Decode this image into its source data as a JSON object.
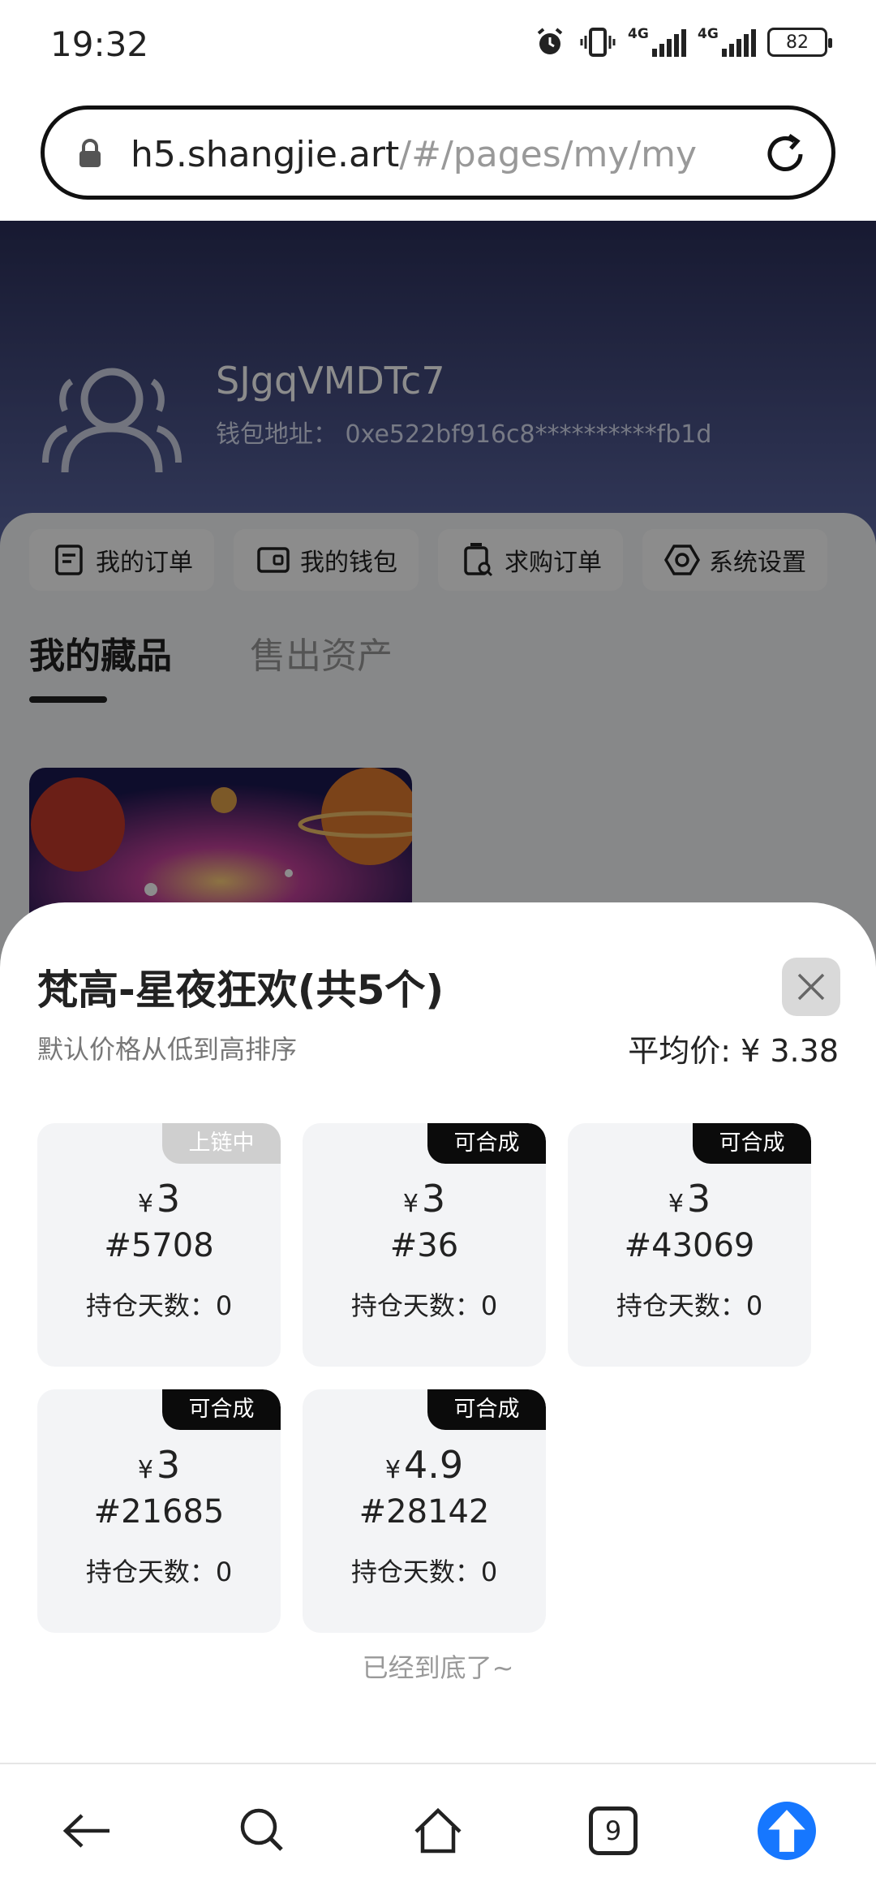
{
  "status_bar": {
    "time": "19:32",
    "network_label": "4G",
    "battery": "82",
    "icons": [
      "alarm-icon",
      "vibrate-icon",
      "signal-4g-icon",
      "signal-4g-icon",
      "battery-icon"
    ]
  },
  "browser": {
    "url_host": "h5.shangjie.art",
    "url_path": "/#/pages/my/my",
    "lock_icon": "lock-icon",
    "reload_icon": "reload-icon"
  },
  "profile": {
    "username": "SJgqVMDTc7",
    "wallet_label": "钱包地址：",
    "wallet_address": "0xe522bf916c8**********fb1d"
  },
  "quick_actions": [
    {
      "label": "我的订单",
      "icon": "order-icon"
    },
    {
      "label": "我的钱包",
      "icon": "wallet-icon"
    },
    {
      "label": "求购订单",
      "icon": "purchase-order-icon"
    },
    {
      "label": "系统设置",
      "icon": "settings-icon"
    }
  ],
  "tabs": [
    {
      "label": "我的藏品",
      "active": true
    },
    {
      "label": "售出资产",
      "active": false
    }
  ],
  "sheet": {
    "title": "梵高-星夜狂欢(共5个)",
    "sort_hint": "默认价格从低到高排序",
    "avg_label": "平均价:",
    "avg_value": "¥ 3.38",
    "currency": "¥",
    "days_label": "持仓天数：",
    "end_hint": "已经到底了~",
    "items": [
      {
        "badge": "上链中",
        "badge_style": "light",
        "price": "3",
        "serial": "#5708",
        "days": "0"
      },
      {
        "badge": "可合成",
        "badge_style": "dark",
        "price": "3",
        "serial": "#36",
        "days": "0"
      },
      {
        "badge": "可合成",
        "badge_style": "dark",
        "price": "3",
        "serial": "#43069",
        "days": "0"
      },
      {
        "badge": "可合成",
        "badge_style": "dark",
        "price": "3",
        "serial": "#21685",
        "days": "0"
      },
      {
        "badge": "可合成",
        "badge_style": "dark",
        "price": "4.9",
        "serial": "#28142",
        "days": "0"
      }
    ]
  },
  "nav_bar": {
    "tabs_count": "9",
    "accent": "#1677ff",
    "icons": [
      "back-icon",
      "search-icon",
      "home-icon",
      "tabs-icon",
      "upload-icon"
    ]
  }
}
